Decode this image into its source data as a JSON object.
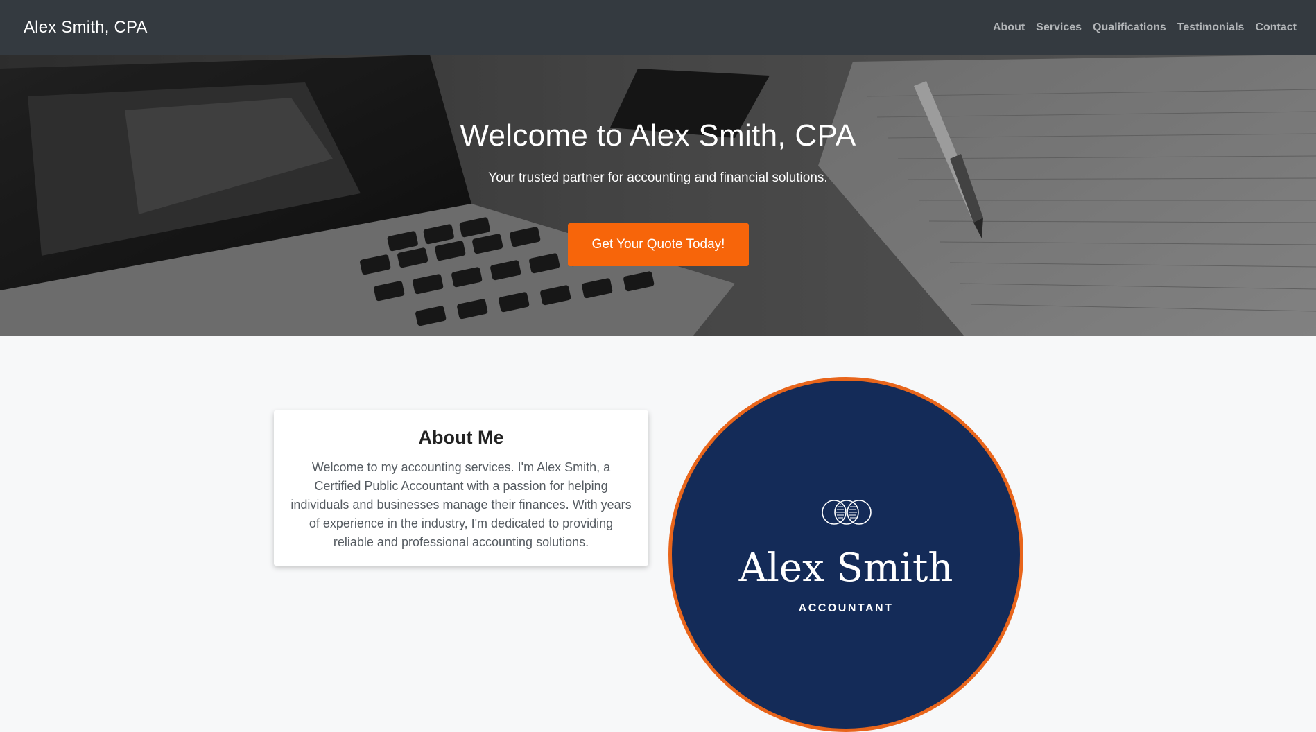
{
  "navbar": {
    "brand": "Alex Smith, CPA",
    "links": [
      "About",
      "Services",
      "Qualifications",
      "Testimonials",
      "Contact"
    ]
  },
  "hero": {
    "title": "Welcome to Alex Smith, CPA",
    "subtitle": "Your trusted partner for accounting and financial solutions.",
    "cta_label": "Get Your Quote Today!",
    "background_icon": "laptop-notebook-pen-photo"
  },
  "about": {
    "title": "About Me",
    "text": "Welcome to my accounting services. I'm Alex Smith, a Certified Public Accountant with a passion for helping individuals and businesses manage their finances. With years of experience in the industry, I'm dedicated to providing reliable and professional accounting solutions."
  },
  "logo": {
    "name": "Alex Smith",
    "role": "ACCOUNTANT",
    "icon": "interlocking-rings-icon"
  },
  "colors": {
    "navbar": "#343a40",
    "accent": "#f7650a",
    "logo_background": "#142b58",
    "logo_border": "#e8651b",
    "page_background": "#f7f8f9"
  }
}
